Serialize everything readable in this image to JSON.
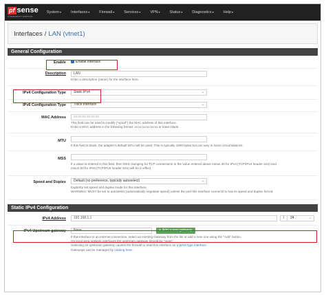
{
  "nav": {
    "logo_pf": "pf",
    "logo_sense": "sense",
    "logo_sub": "COMMUNITY EDITION",
    "items": [
      "System",
      "Interfaces",
      "Firewall",
      "Services",
      "VPN",
      "Status",
      "Diagnostics",
      "Help"
    ]
  },
  "breadcrumb": {
    "parent": "Interfaces",
    "separator": "/",
    "current": "LAN (vtnet1)"
  },
  "general": {
    "header": "General Configuration",
    "enable": {
      "label": "Enable",
      "checkbox_label": "Enable interface"
    },
    "description": {
      "label": "Description",
      "value": "LAN",
      "help": "Enter a description (name) for the interface here."
    },
    "ipv4_type": {
      "label": "IPv4 Configuration Type",
      "value": "Static IPv4"
    },
    "ipv6_type": {
      "label": "IPv6 Configuration Type",
      "value": "Track Interface"
    },
    "mac": {
      "label": "MAC Address",
      "placeholder": "xx:xx:xx:xx:xx:xx",
      "help1": "This field can be used to modify (\"spoof\") the MAC address of this interface.",
      "help2": "Enter a MAC address in the following format: xx:xx:xx:xx:xx:xx or leave blank."
    },
    "mtu": {
      "label": "MTU",
      "help": "If this field is blank, the adapter's default MTU will be used. This is typically 1500 bytes but can vary in some circumstances."
    },
    "mss": {
      "label": "MSS",
      "help1": "If a value is entered in this field, then MSS clamping for TCP connections to the value entered above minus 40 for IPv4 (TCP/IPv4 header size) and",
      "help2": "minus 60 for IPv6 (TCP/IPv6 header size) will be in effect."
    },
    "speed": {
      "label": "Speed and Duplex",
      "value": "Default (no preference, typically autoselect)",
      "help1": "Explicitly set speed and duplex mode for this interface.",
      "help2": "WARNING: MUST be set to autoselect (automatically negotiate speed) unless the port this interface connects to has its speed and duplex forced."
    }
  },
  "static_ipv4": {
    "header": "Static IPv4 Configuration",
    "address": {
      "label": "IPv4 Address",
      "value": "192.168.1.1",
      "slash": "/",
      "cidr": "24"
    },
    "gateway": {
      "label": "IPv4 Upstream gateway",
      "value": "None",
      "add_button": "Add a new gateway",
      "help1": "If this interface is an Internet connection, select an existing Gateway from the list or add a new one using the \"Add\" button.",
      "help2": "On local area network interfaces the upstream gateway should be \"none\".",
      "help3_pre": "Selecting an upstream gateway causes the firewall to treat this interface as a ",
      "help3_link": "WAN type interface",
      "help3_post": ".",
      "help4_pre": "Gateways can be managed by ",
      "help4_link": "clicking here",
      "help4_post": "."
    }
  }
}
